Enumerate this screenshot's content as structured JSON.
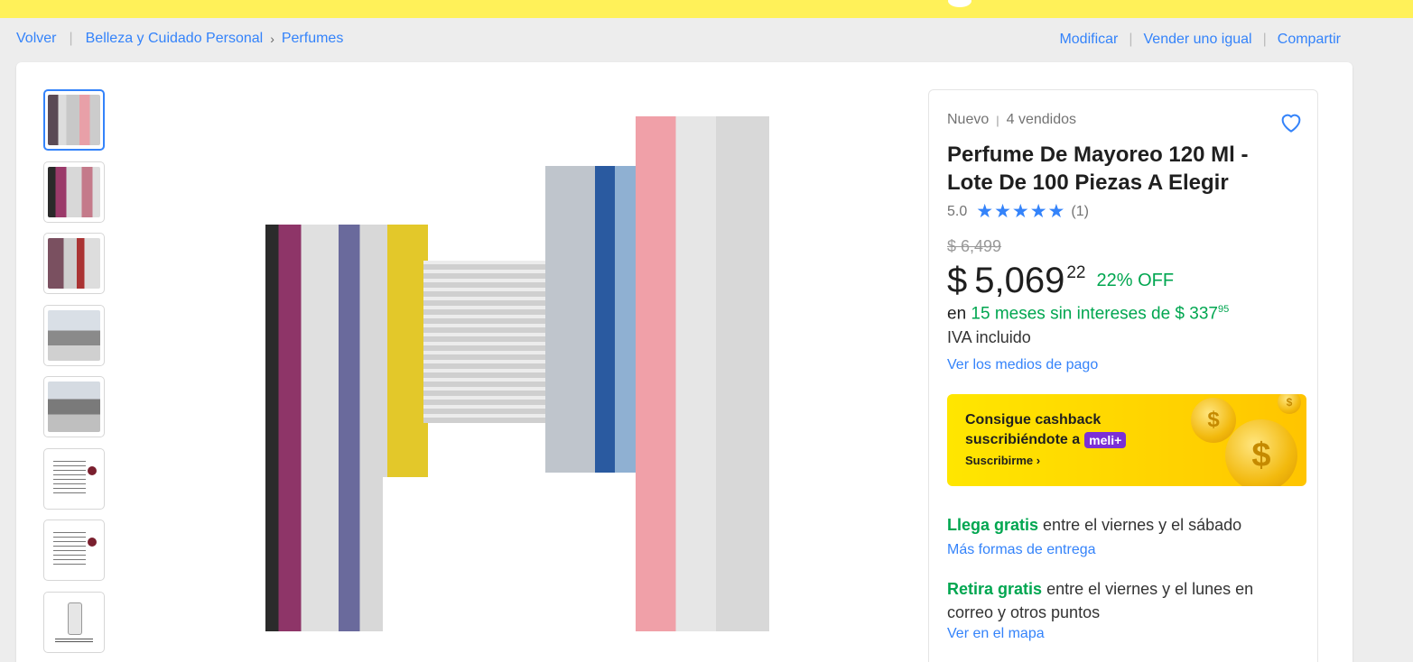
{
  "breadcrumb": {
    "back": "Volver",
    "category": "Belleza y Cuidado Personal",
    "subcategory": "Perfumes"
  },
  "actions": {
    "modify": "Modificar",
    "sell_same": "Vender uno igual",
    "share": "Compartir"
  },
  "product": {
    "condition": "Nuevo",
    "sold": "4 vendidos",
    "title": "Perfume De Mayoreo 120 Ml - Lote De 100 Piezas A Elegir",
    "rating_value": "5.0",
    "stars": "★★★★★",
    "rating_count": "(1)",
    "old_price": "$ 6,499",
    "currency": "$",
    "price": "5,069",
    "cents": "22",
    "discount": "22% OFF",
    "installments_prefix": "en",
    "installments_text": "15 meses sin intereses de $ 337",
    "installments_cents": "95",
    "tax_note": "IVA incluido",
    "payment_link": "Ver los medios de pago"
  },
  "promo": {
    "line1": "Consigue cashback",
    "line2": "suscribiéndote a",
    "badge": "meli+",
    "cta": "Suscribirme",
    "cta_icon": "›"
  },
  "shipping": {
    "delivery_bold": "Llega gratis",
    "delivery_text": "entre el viernes y el sábado",
    "delivery_link": "Más formas de entrega",
    "pickup_bold": "Retira gratis",
    "pickup_text": "entre el viernes y el lunes en correo y otros puntos",
    "pickup_link": "Ver en el mapa"
  },
  "thumbnails": [
    "warehouse-aisle",
    "warehouse-aisle",
    "warehouse-aisle",
    "store-floor",
    "store-floor",
    "info-sheet",
    "description-sheet",
    "perfume-bottle"
  ],
  "colors": {
    "brand_yellow": "#fff159",
    "link_blue": "#3483fa",
    "discount_green": "#00a650"
  }
}
